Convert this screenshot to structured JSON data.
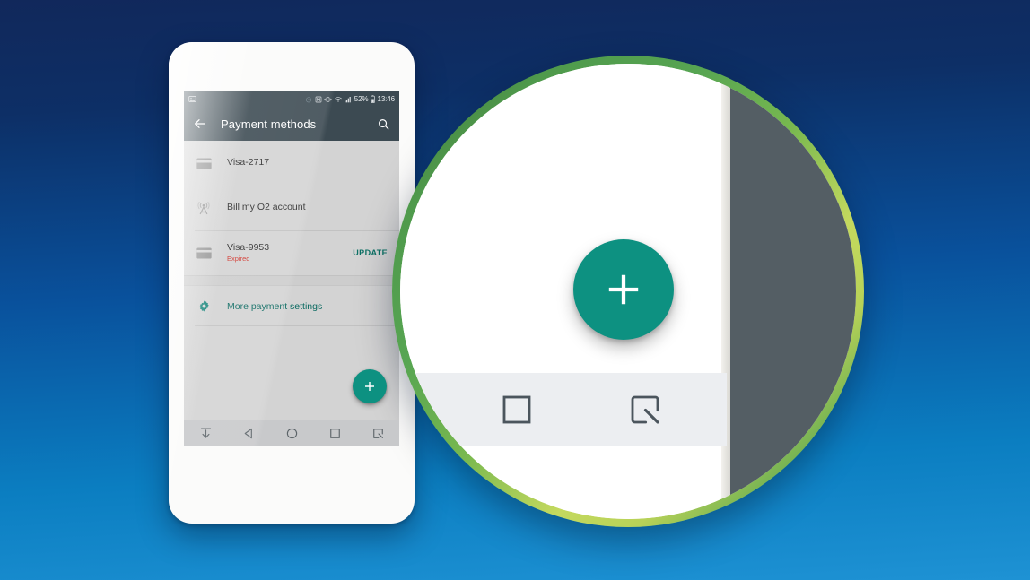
{
  "background": {
    "gradient_top": "#11285b",
    "gradient_bottom": "#1e92d4"
  },
  "phone": {
    "device_chrome_color": "#fbfbfa",
    "status_bar": {
      "background": "#3c4a52",
      "left_icons": [
        "image-icon"
      ],
      "right_icons": [
        "alarm-icon",
        "nfc-icon",
        "vibrate-icon",
        "wifi-icon",
        "signal-icon"
      ],
      "battery_percent": "52%",
      "battery_icon": "battery-icon",
      "time": "13:46"
    },
    "app_bar": {
      "background": "#3c4a52",
      "back_icon": "back-arrow-icon",
      "title": "Payment methods",
      "search_icon": "search-icon"
    },
    "payment_methods": [
      {
        "icon": "credit-card-icon",
        "title": "Visa-2717",
        "subtitle": "",
        "action": ""
      },
      {
        "icon": "cell-tower-icon",
        "title": "Bill my O2 account",
        "subtitle": "",
        "action": ""
      },
      {
        "icon": "credit-card-icon",
        "title": "Visa-9953",
        "subtitle": "Expired",
        "action": "UPDATE"
      }
    ],
    "settings_row": {
      "icon": "gear-icon",
      "label": "More payment settings",
      "label_color": "#0b6a61"
    },
    "fab": {
      "icon": "plus-icon",
      "color": "#0d9181"
    },
    "nav_bar": {
      "background": "#c8c9cb",
      "items": [
        {
          "icon": "hide-navbar-icon"
        },
        {
          "icon": "back-triangle-icon"
        },
        {
          "icon": "home-circle-icon"
        },
        {
          "icon": "recents-square-icon"
        },
        {
          "icon": "screen-capture-icon"
        }
      ]
    }
  },
  "magnifier": {
    "ring_color_light": "#c4d95e",
    "ring_color_dark": "#3e6c35",
    "fab": {
      "icon": "plus-icon",
      "color": "#0d9181"
    },
    "nav_items": [
      {
        "icon": "recents-square-icon"
      },
      {
        "icon": "screen-capture-icon"
      }
    ]
  }
}
